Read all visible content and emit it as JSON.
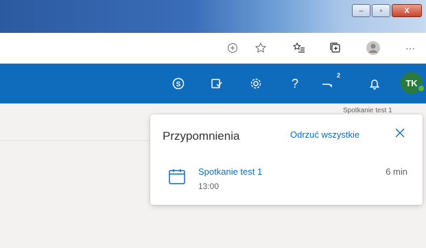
{
  "window": {
    "minimize_label": "–",
    "maximize_label": "▫",
    "close_label": "X"
  },
  "toolbar_icons": {
    "add": "add-circle-icon",
    "favorite": "star-icon",
    "favorites_list": "favorites-list-icon",
    "collections": "collections-icon",
    "profile": "profile-icon",
    "more": "···"
  },
  "appbar": {
    "chat_badge": "2",
    "avatar_initials": "TK"
  },
  "page": {
    "subtext": "Spotkanie test 1"
  },
  "reminders": {
    "title": "Przypomnienia",
    "dismiss_all": "Odrzuć wszystkie",
    "items": [
      {
        "title": "Spotkanie test 1",
        "time": "13:00",
        "due": "6 min"
      }
    ]
  },
  "colors": {
    "accent": "#0f6cbd",
    "presence": "#6bb700"
  }
}
